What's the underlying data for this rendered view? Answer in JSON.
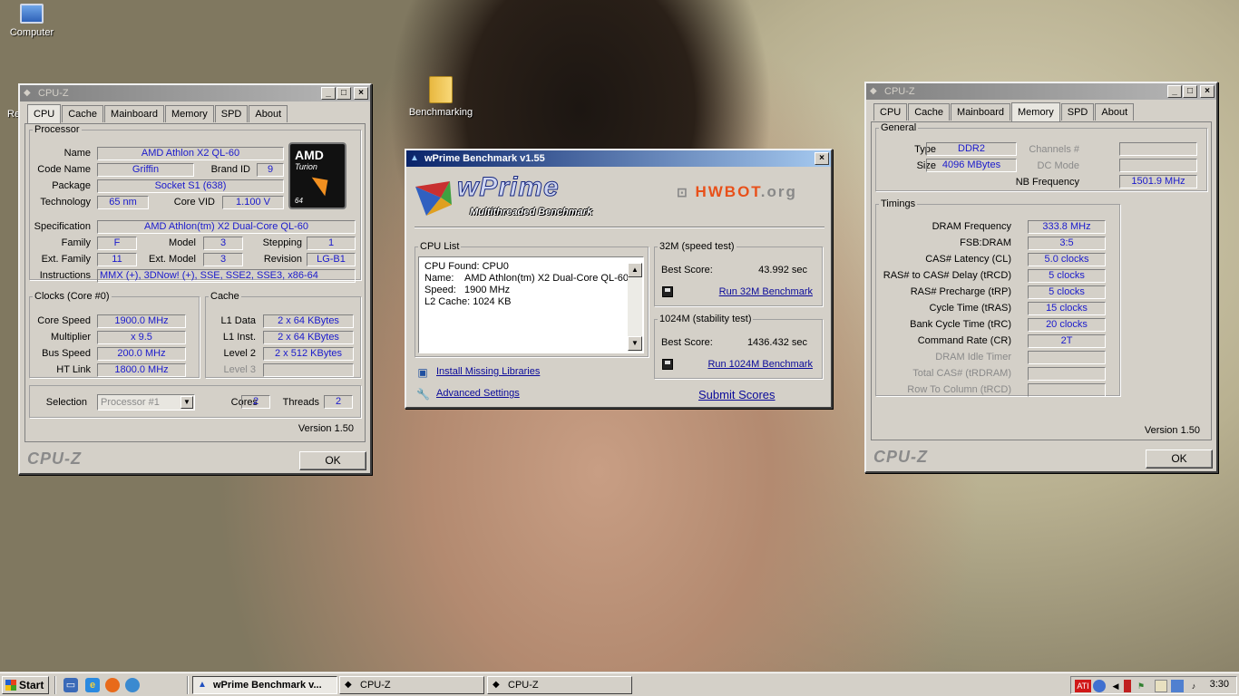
{
  "desktop": {
    "icons": [
      {
        "label": "Computer"
      },
      {
        "label": "Benchmarking"
      }
    ],
    "partial_icon_label": "Re"
  },
  "cpuz_left": {
    "title": "CPU-Z",
    "tabs": [
      "CPU",
      "Cache",
      "Mainboard",
      "Memory",
      "SPD",
      "About"
    ],
    "selected_tab": "CPU",
    "processor": {
      "legend": "Processor",
      "name_label": "Name",
      "name": "AMD Athlon X2 QL-60",
      "codename_label": "Code Name",
      "codename": "Griffin",
      "brandid_label": "Brand ID",
      "brandid": "9",
      "package_label": "Package",
      "package": "Socket S1 (638)",
      "technology_label": "Technology",
      "technology": "65 nm",
      "corevid_label": "Core VID",
      "corevid": "1.100 V",
      "spec_label": "Specification",
      "spec": "AMD Athlon(tm) X2 Dual-Core QL-60",
      "family_label": "Family",
      "family": "F",
      "model_label": "Model",
      "model": "3",
      "stepping_label": "Stepping",
      "stepping": "1",
      "extfamily_label": "Ext. Family",
      "extfamily": "11",
      "extmodel_label": "Ext. Model",
      "extmodel": "3",
      "revision_label": "Revision",
      "revision": "LG-B1",
      "instructions_label": "Instructions",
      "instructions": "MMX (+), 3DNow! (+), SSE, SSE2, SSE3, x86-64",
      "logo": {
        "brand": "AMD",
        "line": "Turion",
        "bits": "64"
      }
    },
    "clocks": {
      "legend": "Clocks (Core #0)",
      "corespeed_label": "Core Speed",
      "corespeed": "1900.0 MHz",
      "multiplier_label": "Multiplier",
      "multiplier": "x 9.5",
      "busspeed_label": "Bus Speed",
      "busspeed": "200.0 MHz",
      "htlink_label": "HT Link",
      "htlink": "1800.0 MHz"
    },
    "cache": {
      "legend": "Cache",
      "l1data_label": "L1 Data",
      "l1data": "2 x 64 KBytes",
      "l1inst_label": "L1 Inst.",
      "l1inst": "2 x 64 KBytes",
      "level2_label": "Level 2",
      "level2": "2 x 512 KBytes",
      "level3_label": "Level 3",
      "level3": ""
    },
    "selection_label": "Selection",
    "selection": "Processor #1",
    "cores_label": "Cores",
    "cores": "2",
    "threads_label": "Threads",
    "threads": "2",
    "version": "Version 1.50",
    "brand": "CPU-Z",
    "ok_label": "OK"
  },
  "wprime": {
    "title": "wPrime Benchmark v1.55",
    "logo_title": "wPrime",
    "logo_sub": "Multithreaded Benchmark",
    "hwbot_hw": "HWBOT",
    "hwbot_rest": ".org",
    "cpu_list_legend": "CPU List",
    "cpu_list_lines": [
      "CPU Found: CPU0",
      "Name:    AMD Athlon(tm) X2 Dual-Core QL-60",
      "Speed:   1900 MHz",
      "L2 Cache: 1024 KB"
    ],
    "test32": {
      "legend": "32M (speed test)",
      "best_label": "Best Score:",
      "best": "43.992 sec",
      "run_label": "Run 32M Benchmark"
    },
    "test1024": {
      "legend": "1024M (stability test)",
      "best_label": "Best Score:",
      "best": "1436.432 sec",
      "run_label": "Run 1024M Benchmark"
    },
    "install_label": "Install Missing Libraries",
    "advanced_label": "Advanced Settings",
    "submit_label": "Submit Scores"
  },
  "cpuz_right": {
    "title": "CPU-Z",
    "tabs": [
      "CPU",
      "Cache",
      "Mainboard",
      "Memory",
      "SPD",
      "About"
    ],
    "selected_tab": "Memory",
    "general": {
      "legend": "General",
      "type_label": "Type",
      "type": "DDR2",
      "size_label": "Size",
      "size": "4096 MBytes",
      "channels_label": "Channels #",
      "channels": "",
      "dcmode_label": "DC Mode",
      "dcmode": "",
      "nbfreq_label": "NB Frequency",
      "nbfreq": "1501.9 MHz"
    },
    "timings": {
      "legend": "Timings",
      "rows": [
        {
          "label": "DRAM Frequency",
          "value": "333.8 MHz",
          "enabled": true
        },
        {
          "label": "FSB:DRAM",
          "value": "3:5",
          "enabled": true
        },
        {
          "label": "CAS# Latency (CL)",
          "value": "5.0 clocks",
          "enabled": true
        },
        {
          "label": "RAS# to CAS# Delay (tRCD)",
          "value": "5 clocks",
          "enabled": true
        },
        {
          "label": "RAS# Precharge (tRP)",
          "value": "5 clocks",
          "enabled": true
        },
        {
          "label": "Cycle Time (tRAS)",
          "value": "15 clocks",
          "enabled": true
        },
        {
          "label": "Bank Cycle Time (tRC)",
          "value": "20 clocks",
          "enabled": true
        },
        {
          "label": "Command Rate (CR)",
          "value": "2T",
          "enabled": true
        },
        {
          "label": "DRAM Idle Timer",
          "value": "",
          "enabled": false
        },
        {
          "label": "Total CAS# (tRDRAM)",
          "value": "",
          "enabled": false
        },
        {
          "label": "Row To Column (tRCD)",
          "value": "",
          "enabled": false
        }
      ]
    },
    "version": "Version 1.50",
    "brand": "CPU-Z",
    "ok_label": "OK"
  },
  "taskbar": {
    "start_label": "Start",
    "buttons": [
      {
        "label": "wPrime Benchmark v...",
        "active": true
      },
      {
        "label": "CPU-Z",
        "active": false
      },
      {
        "label": "CPU-Z",
        "active": false
      }
    ],
    "tray_ati": "ATI",
    "clock": "3:30"
  },
  "colors": {
    "value_text": "#1a1acc",
    "active_title": "#0a246a",
    "link": "#0a0a9a"
  }
}
